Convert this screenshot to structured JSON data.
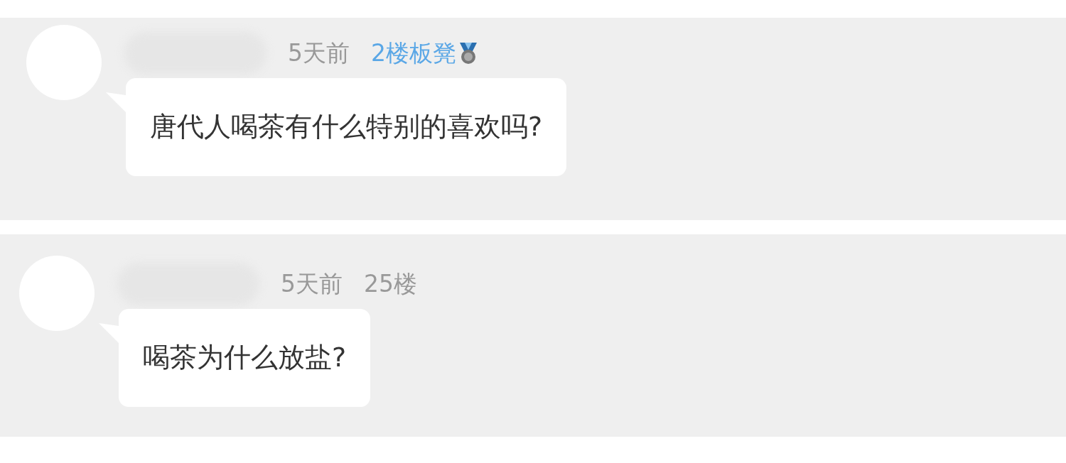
{
  "comments": [
    {
      "time": "5天前",
      "floor": {
        "text": "2楼板凳",
        "kind": "highlight"
      },
      "message": "唐代人喝茶有什么特别的喜欢吗?"
    },
    {
      "time": "5天前",
      "floor": {
        "text": "25楼",
        "kind": "plain"
      },
      "message": "喝茶为什么放盐?"
    }
  ]
}
